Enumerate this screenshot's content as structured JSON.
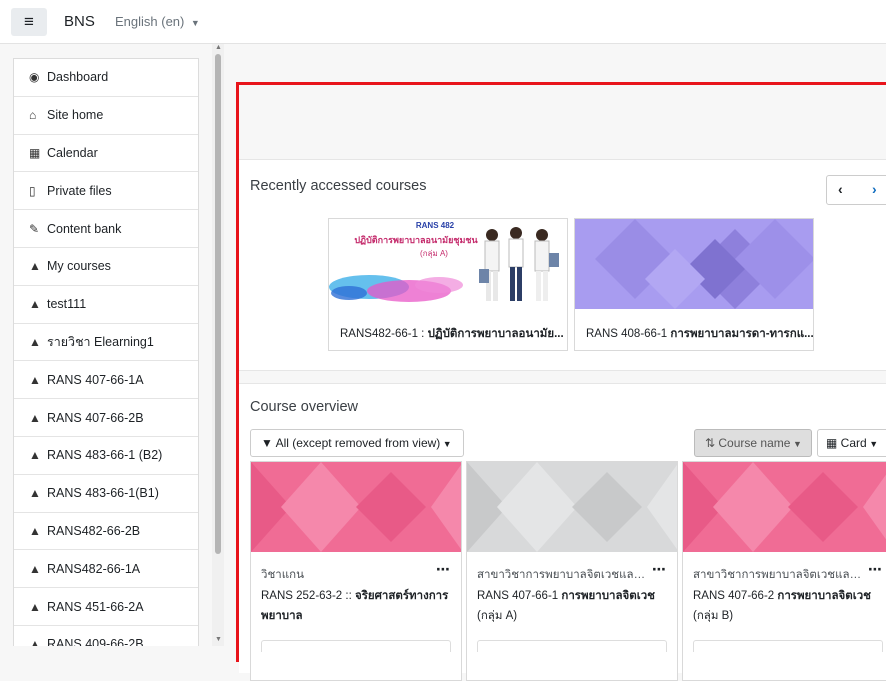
{
  "header": {
    "brand": "BNS",
    "language": "English (en)"
  },
  "sidebar": {
    "items": [
      {
        "label": "Dashboard",
        "icon": "dashboard-icon"
      },
      {
        "label": "Site home",
        "icon": "home-icon"
      },
      {
        "label": "Calendar",
        "icon": "calendar-icon"
      },
      {
        "label": "Private files",
        "icon": "file-icon"
      },
      {
        "label": "Content bank",
        "icon": "brush-icon"
      },
      {
        "label": "My courses",
        "icon": "graduation-cap-icon"
      },
      {
        "label": "test111",
        "icon": "graduation-cap-icon"
      },
      {
        "label": "รายวิชา Elearning1",
        "icon": "graduation-cap-icon"
      },
      {
        "label": "RANS 407-66-1A",
        "icon": "graduation-cap-icon"
      },
      {
        "label": "RANS 407-66-2B",
        "icon": "graduation-cap-icon"
      },
      {
        "label": "RANS 483-66-1 (B2)",
        "icon": "graduation-cap-icon"
      },
      {
        "label": "RANS 483-66-1(B1)",
        "icon": "graduation-cap-icon"
      },
      {
        "label": "RANS482-66-2B",
        "icon": "graduation-cap-icon"
      },
      {
        "label": "RANS482-66-1A",
        "icon": "graduation-cap-icon"
      },
      {
        "label": "RANS 451-66-2A",
        "icon": "graduation-cap-icon"
      },
      {
        "label": "RANS 409-66-2B",
        "icon": "graduation-cap-icon"
      }
    ]
  },
  "recent": {
    "title": "Recently accessed courses",
    "banner_code": "RANS 482",
    "banner_title": "ปฏิบัติการพยาบาลอนามัยชุมชน",
    "banner_group": "(กลุ่ม A)",
    "cards": [
      {
        "code": "RANS482-66-1 : ",
        "name": "ปฏิบัติการพยาบาลอนามัย..."
      },
      {
        "code": "RANS 408-66-1 ",
        "name": "การพยาบาลมารดา-ทารกแ..."
      }
    ]
  },
  "overview": {
    "title": "Course overview",
    "filter": "All (except removed from view)",
    "sort": "Course name",
    "view": "Card",
    "courses": [
      {
        "category": "วิชาแกน",
        "code": "RANS 252-63-2 :: ",
        "name": "จริยศาสตร์ทางการพยาบาล",
        "suffix": "",
        "color": "#f06c95"
      },
      {
        "category": "สาขาวิชาการพยาบาลจิตเวชและ...",
        "code": "RANS 407-66-1 ",
        "name": "การพยาบาลจิตเวช",
        "suffix": " (กลุ่ม A)",
        "color": "#d8d9da"
      },
      {
        "category": "สาขาวิชาการพยาบาลจิตเวชและ...",
        "code": "RANS 407-66-2 ",
        "name": "การพยาบาลจิตเวช",
        "suffix": " (กลุ่ม B)",
        "color": "#f06c95"
      }
    ]
  }
}
